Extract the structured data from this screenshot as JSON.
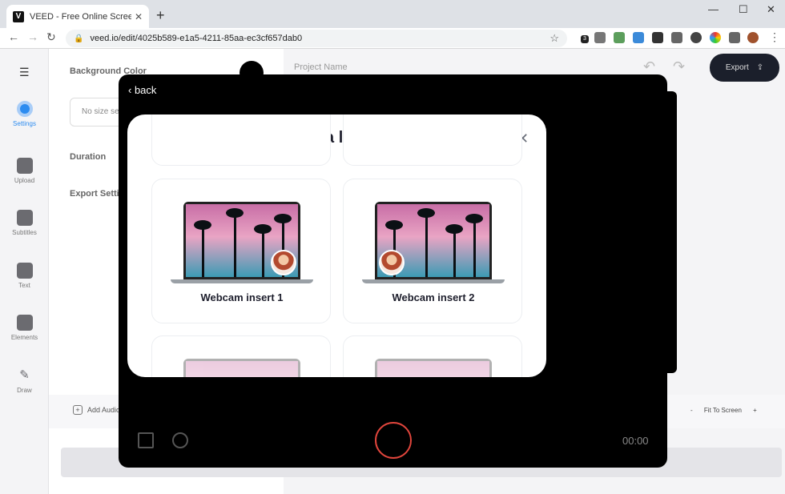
{
  "browser": {
    "tab_title": "VEED - Free Online Screen & We",
    "tab_favicon": "V",
    "url": "veed.io/edit/4025b589-e1a5-4211-85aa-ec3cf657dab0",
    "ext_badge": "3"
  },
  "app": {
    "menu_icon": "hamburger-icon",
    "nav": [
      {
        "label": "Settings",
        "icon": "settings-icon"
      },
      {
        "label": "Upload",
        "icon": "upload-icon"
      },
      {
        "label": "Subtitles",
        "icon": "subtitles-icon"
      },
      {
        "label": "Text",
        "icon": "text-icon"
      },
      {
        "label": "Elements",
        "icon": "elements-icon"
      },
      {
        "label": "Draw",
        "icon": "draw-icon"
      }
    ],
    "settings": {
      "background_color_label": "Background Color",
      "size_placeholder": "No size sel",
      "duration_label": "Duration",
      "export_settings_label": "Export Settin"
    },
    "project_name": "Project Name",
    "export_label": "Export",
    "add_audio_label": "Add Audio",
    "fit_to_screen": "Fit To Screen",
    "zoom_minus": "-",
    "zoom_plus": "+"
  },
  "recorder": {
    "back_label": "back",
    "timer": "00:00"
  },
  "layout_dialog": {
    "title": "Pick a layout",
    "close_icon": "close-icon",
    "layouts": [
      {
        "name": "Webcam insert 1",
        "webcam_position": "bottom-right"
      },
      {
        "name": "Webcam insert 2",
        "webcam_position": "bottom-left"
      }
    ]
  },
  "colors": {
    "accent": "#2d8cf0",
    "record": "#e0453c",
    "export_bg": "#1b1f2b"
  }
}
